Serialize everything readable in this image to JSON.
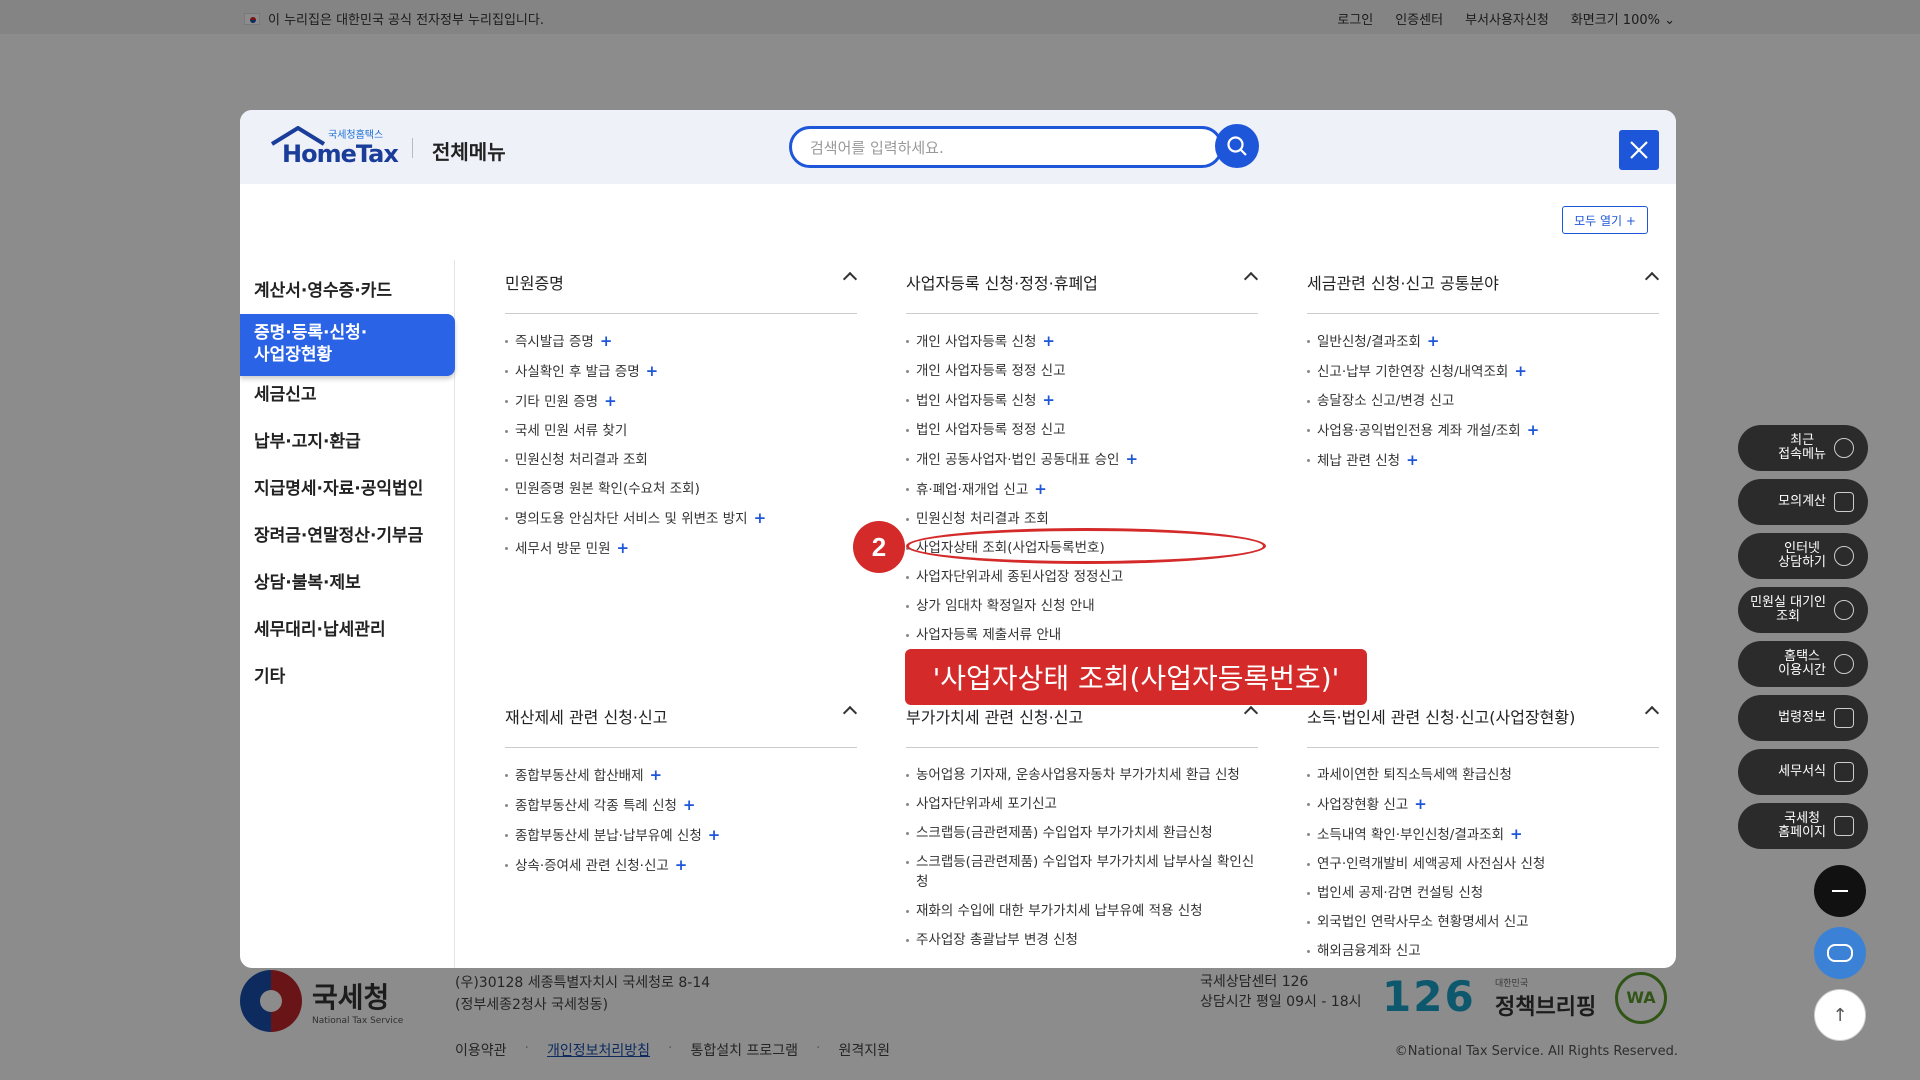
{
  "topbar": {
    "gov_notice": "이 누리집은 대한민국 공식 전자정부 누리집입니다.",
    "links": [
      "로그인",
      "인증센터",
      "부서사용자신청",
      "화면크기 100%"
    ]
  },
  "modal": {
    "logo_small": "국세청홈택스",
    "logo_main": "HomeTax",
    "title": "전체메뉴",
    "search_placeholder": "검색어를 입력하세요.",
    "open_all": "모두 열기 +"
  },
  "left_nav": [
    "계산서·영수증·카드",
    "증명·등록·신청·\n사업장현황",
    "세금신고",
    "납부·고지·환급",
    "지급명세·자료·공익법인",
    "장려금·연말정산·기부금",
    "상담·불복·제보",
    "세무대리·납세관리",
    "기타"
  ],
  "sections": [
    {
      "title": "민원증명",
      "items": [
        {
          "label": "즉시발급 증명",
          "plus": true
        },
        {
          "label": "사실확인 후 발급 증명",
          "plus": true
        },
        {
          "label": "기타 민원 증명",
          "plus": true
        },
        {
          "label": "국세 민원 서류 찾기",
          "plus": false
        },
        {
          "label": "민원신청 처리결과 조회",
          "plus": false
        },
        {
          "label": "민원증명 원본 확인(수요처 조회)",
          "plus": false
        },
        {
          "label": "명의도용 안심차단 서비스 및 위변조 방지",
          "plus": true
        },
        {
          "label": "세무서 방문 민원",
          "plus": true
        }
      ]
    },
    {
      "title": "사업자등록 신청·정정·휴폐업",
      "items": [
        {
          "label": "개인 사업자등록 신청",
          "plus": true
        },
        {
          "label": "개인 사업자등록 정정 신고",
          "plus": false
        },
        {
          "label": "법인 사업자등록 신청",
          "plus": true
        },
        {
          "label": "법인 사업자등록 정정 신고",
          "plus": false
        },
        {
          "label": "개인 공동사업자·법인 공동대표 승인",
          "plus": true
        },
        {
          "label": "휴·폐업·재개업 신고",
          "plus": true
        },
        {
          "label": "민원신청 처리결과 조회",
          "plus": false
        },
        {
          "label": "사업자상태 조회(사업자등록번호)",
          "plus": false
        },
        {
          "label": "사업자단위과세 종된사업장 정정신고",
          "plus": false
        },
        {
          "label": "상가 임대차 확정일자 신청 안내",
          "plus": false
        },
        {
          "label": "사업자등록 제출서류 안내",
          "plus": false
        }
      ]
    },
    {
      "title": "세금관련 신청·신고 공통분야",
      "items": [
        {
          "label": "일반신청/결과조회",
          "plus": true
        },
        {
          "label": "신고·납부 기한연장 신청/내역조회",
          "plus": true
        },
        {
          "label": "송달장소 신고/변경 신고",
          "plus": false
        },
        {
          "label": "사업용·공익법인전용 계좌 개설/조회",
          "plus": true
        },
        {
          "label": "체납 관련 신청",
          "plus": true
        }
      ]
    },
    {
      "title": "재산제세 관련 신청·신고",
      "items": [
        {
          "label": "종합부동산세 합산배제",
          "plus": true
        },
        {
          "label": "종합부동산세 각종 특례 신청",
          "plus": true
        },
        {
          "label": "종합부동산세 분납·납부유예 신청",
          "plus": true
        },
        {
          "label": "상속·증여세 관련 신청·신고",
          "plus": true
        }
      ]
    },
    {
      "title": "부가가치세 관련 신청·신고",
      "items": [
        {
          "label": "농어업용 기자재, 운송사업용자동차 부가가치세 환급 신청",
          "plus": false
        },
        {
          "label": "사업자단위과세 포기신고",
          "plus": false
        },
        {
          "label": "스크랩등(금관련제품) 수입업자 부가가치세 환급신청",
          "plus": false
        },
        {
          "label": "스크랩등(금관련제품) 수입업자 부가가치세 납부사실 확인신청",
          "plus": false
        },
        {
          "label": "재화의 수입에 대한 부가가치세 납부유예 적용 신청",
          "plus": false
        },
        {
          "label": "주사업장 총괄납부 변경 신청",
          "plus": false
        }
      ]
    },
    {
      "title": "소득·법인세 관련 신청·신고(사업장현황)",
      "items": [
        {
          "label": "과세이연한 퇴직소득세액 환급신청",
          "plus": false
        },
        {
          "label": "사업장현황 신고",
          "plus": true
        },
        {
          "label": "소득내역 확인·부인신청/결과조회",
          "plus": true
        },
        {
          "label": "연구·인력개발비 세액공제 사전심사 신청",
          "plus": false
        },
        {
          "label": "법인세 공제·감면 컨설팅 신청",
          "plus": false
        },
        {
          "label": "외국법인 연락사무소 현황명세서 신고",
          "plus": false
        },
        {
          "label": "해외금융계좌 신고",
          "plus": false
        }
      ]
    }
  ],
  "annotation": {
    "step": "2",
    "callout": "'사업자상태 조회(사업자등록번호)'"
  },
  "side_menu": [
    "최근\n접속메뉴",
    "모의계산",
    "인터넷\n상담하기",
    "민원실 대기인\n조회",
    "홈택스\n이용시간",
    "법령정보",
    "세무서식",
    "국세청\n홈페이지"
  ],
  "footer": {
    "org_name": "국세청",
    "org_en": "National Tax Service",
    "address1": "(우)30128 세종특별자치시 국세청로 8-14",
    "address2": "(정부세종2청사 국세청동)",
    "links": [
      "이용약관",
      "개인정보처리방침",
      "통합설치 프로그램",
      "원격지원"
    ],
    "center_name": "국세상담센터 126",
    "center_hours": "상담시간 평일 09시 - 18시",
    "num126": "126",
    "brief_small": "대한민국",
    "brief": "정책브리핑",
    "wa": "WA",
    "copyright": "©National Tax Service. All Rights Reserved."
  }
}
